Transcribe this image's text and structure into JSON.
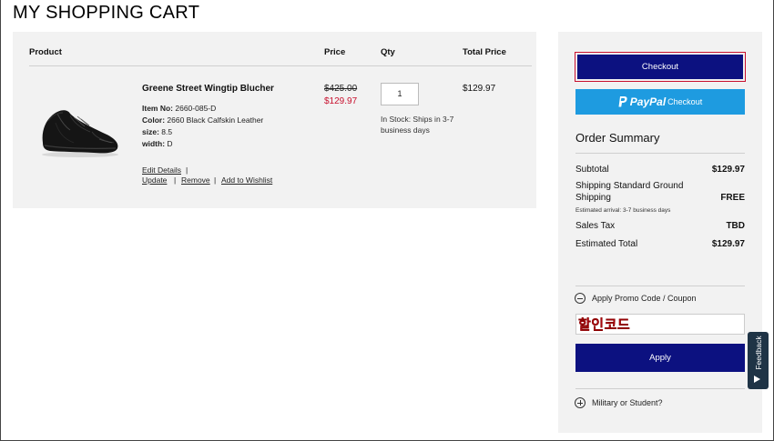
{
  "page": {
    "title": "MY SHOPPING CART"
  },
  "cart": {
    "columns": {
      "product": "Product",
      "price": "Price",
      "qty": "Qty",
      "total": "Total Price"
    },
    "item": {
      "name": "Greene Street Wingtip Blucher",
      "item_no_label": "Item No:",
      "item_no": "2660-085-D",
      "color_label": "Color:",
      "color": "2660 Black Calfskin Leather",
      "size_label": "size:",
      "size": "8.5",
      "width_label": "width:",
      "width": "D",
      "original_price": "$425.00",
      "sale_price": "$129.97",
      "quantity": "1",
      "stock_status": "In Stock: Ships in 3-7 business days",
      "total_price": "$129.97",
      "image_icon": "wingtip-shoe-image"
    },
    "actions": {
      "edit_details": "Edit Details",
      "update": "Update",
      "remove": "Remove",
      "add_to_wishlist": "Add to Wishlist",
      "separator": "|"
    }
  },
  "summary": {
    "checkout_label": "Checkout",
    "paypal_label": "PayPal",
    "paypal_checkout_label": "Checkout",
    "title": "Order Summary",
    "subtotal_label": "Subtotal",
    "subtotal_value": "$129.97",
    "shipping_label_line1": "Shipping Standard Ground",
    "shipping_label_line2": "Shipping",
    "shipping_value": "FREE",
    "shipping_note": "Estimated arrival: 3-7 business days",
    "tax_label": "Sales Tax",
    "tax_value": "TBD",
    "estimated_total_label": "Estimated Total",
    "estimated_total_value": "$129.97",
    "promo_toggle_label": "Apply Promo Code / Coupon",
    "promo_value": "할인코드",
    "apply_label": "Apply",
    "military_label": "Military or Student?"
  },
  "feedback": {
    "label": "Feedback"
  },
  "colors": {
    "navy": "#0c1180",
    "paypal_blue": "#1e9be0",
    "sale_red": "#c8102e",
    "panel_grey": "#f2f2f2",
    "feedback_bg": "#1f3446"
  }
}
